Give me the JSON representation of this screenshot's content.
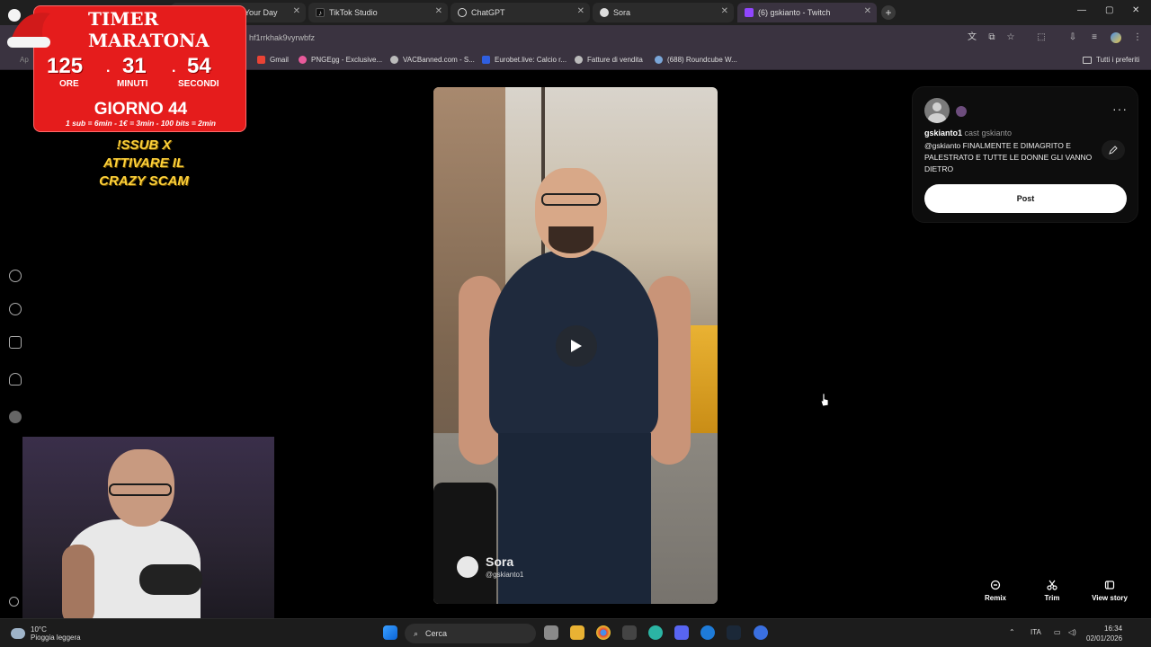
{
  "browser": {
    "tabs": [
      {
        "title": "ike Your Day",
        "color": "#ffffff"
      },
      {
        "title": "TikTok Studio",
        "color": "#111111"
      },
      {
        "title": "ChatGPT",
        "color": "#ffffff"
      },
      {
        "title": "Sora",
        "color": "#ffffff"
      },
      {
        "title": "(6) gskianto - Twitch",
        "color": "#9146ff"
      }
    ],
    "new_tab": "+",
    "controls": {
      "minimize": "—",
      "maximize": "▢",
      "close": "✕"
    },
    "url": "hf1rrkhak9vyrwbfz",
    "bookmarks": [
      {
        "label": "Gmail",
        "color": "#ea4335"
      },
      {
        "label": "PNGEgg - Exclusive...",
        "color": "#e85a9b"
      },
      {
        "label": "VACBanned.com - S...",
        "color": "#bbbbbb"
      },
      {
        "label": "Eurobet.live: Calcio r...",
        "color": "#2f5fe0"
      },
      {
        "label": "Fatture di vendita",
        "color": "#bbbbbb"
      },
      {
        "label": "(688) Roundcube W...",
        "color": "#7aa6d8"
      }
    ],
    "all_bookmarks": "Tutti i preferiti",
    "apps_fragment": "Ap"
  },
  "stream_overlay": {
    "title": "TIMER MARATONA",
    "hours": "125",
    "minutes": "31",
    "seconds": "54",
    "hours_label": "ORE",
    "minutes_label": "MINUTI",
    "seconds_label": "SECONDI",
    "day": "GIORNO 44",
    "rules": "1 sub = 6min - 1€ = 3min - 100 bits = 2min",
    "command_line1": "!SSUB X",
    "command_line2": "ATTIVARE IL",
    "command_line3": "CRAZY SCAM"
  },
  "video": {
    "watermark_name": "Sora",
    "watermark_handle": "@gskianto1"
  },
  "post_card": {
    "username": "gskianto1",
    "cast_text": "cast gskianto",
    "caption": "@gskianto FINALMENTE E DIMAGRITO E PALESTRATO E TUTTE LE DONNE GLI VANNO DIETRO",
    "more_label": "···",
    "post_button": "Post"
  },
  "actions": {
    "remix": "Remix",
    "trim": "Trim",
    "view_story": "View story"
  },
  "taskbar": {
    "temperature": "10°C",
    "weather": "Pioggia leggera",
    "search_label": "Cerca",
    "language": "ITA",
    "time": "16:34",
    "date": "02/01/2026"
  }
}
